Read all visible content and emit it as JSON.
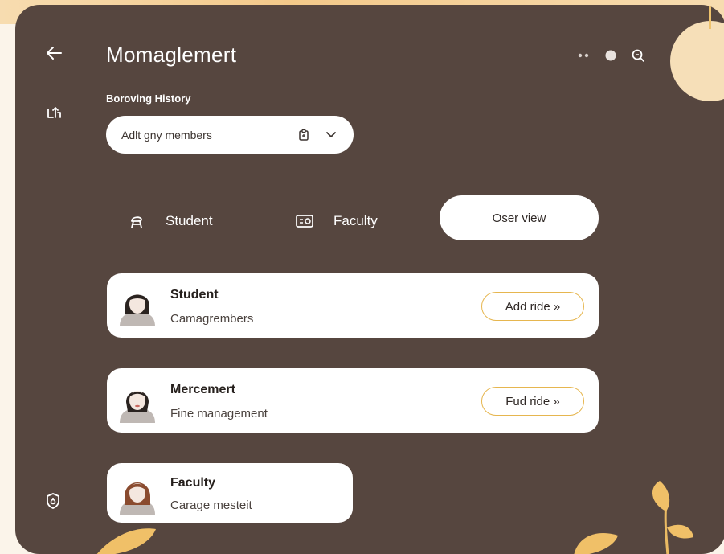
{
  "header": {
    "title": "Momaglemert"
  },
  "section": {
    "label": "Boroving History"
  },
  "dropdown": {
    "value": "Adlt gny members"
  },
  "tabs": [
    {
      "label": "Student",
      "icon": "chair-icon"
    },
    {
      "label": "Faculty",
      "icon": "id-card-icon"
    },
    {
      "label": "Oser view"
    }
  ],
  "cards": [
    {
      "name": "Student",
      "subtitle": "Camagrembers",
      "button": "Add ride »"
    },
    {
      "name": "Mercemert",
      "subtitle": "Fine management",
      "button": "Fud ride »"
    },
    {
      "name": "Faculty",
      "subtitle": "Carage mesteit"
    }
  ],
  "colors": {
    "panel": "#56463f",
    "accent": "#e6b64f",
    "card": "#ffffff",
    "background": "#fbf4ea"
  }
}
